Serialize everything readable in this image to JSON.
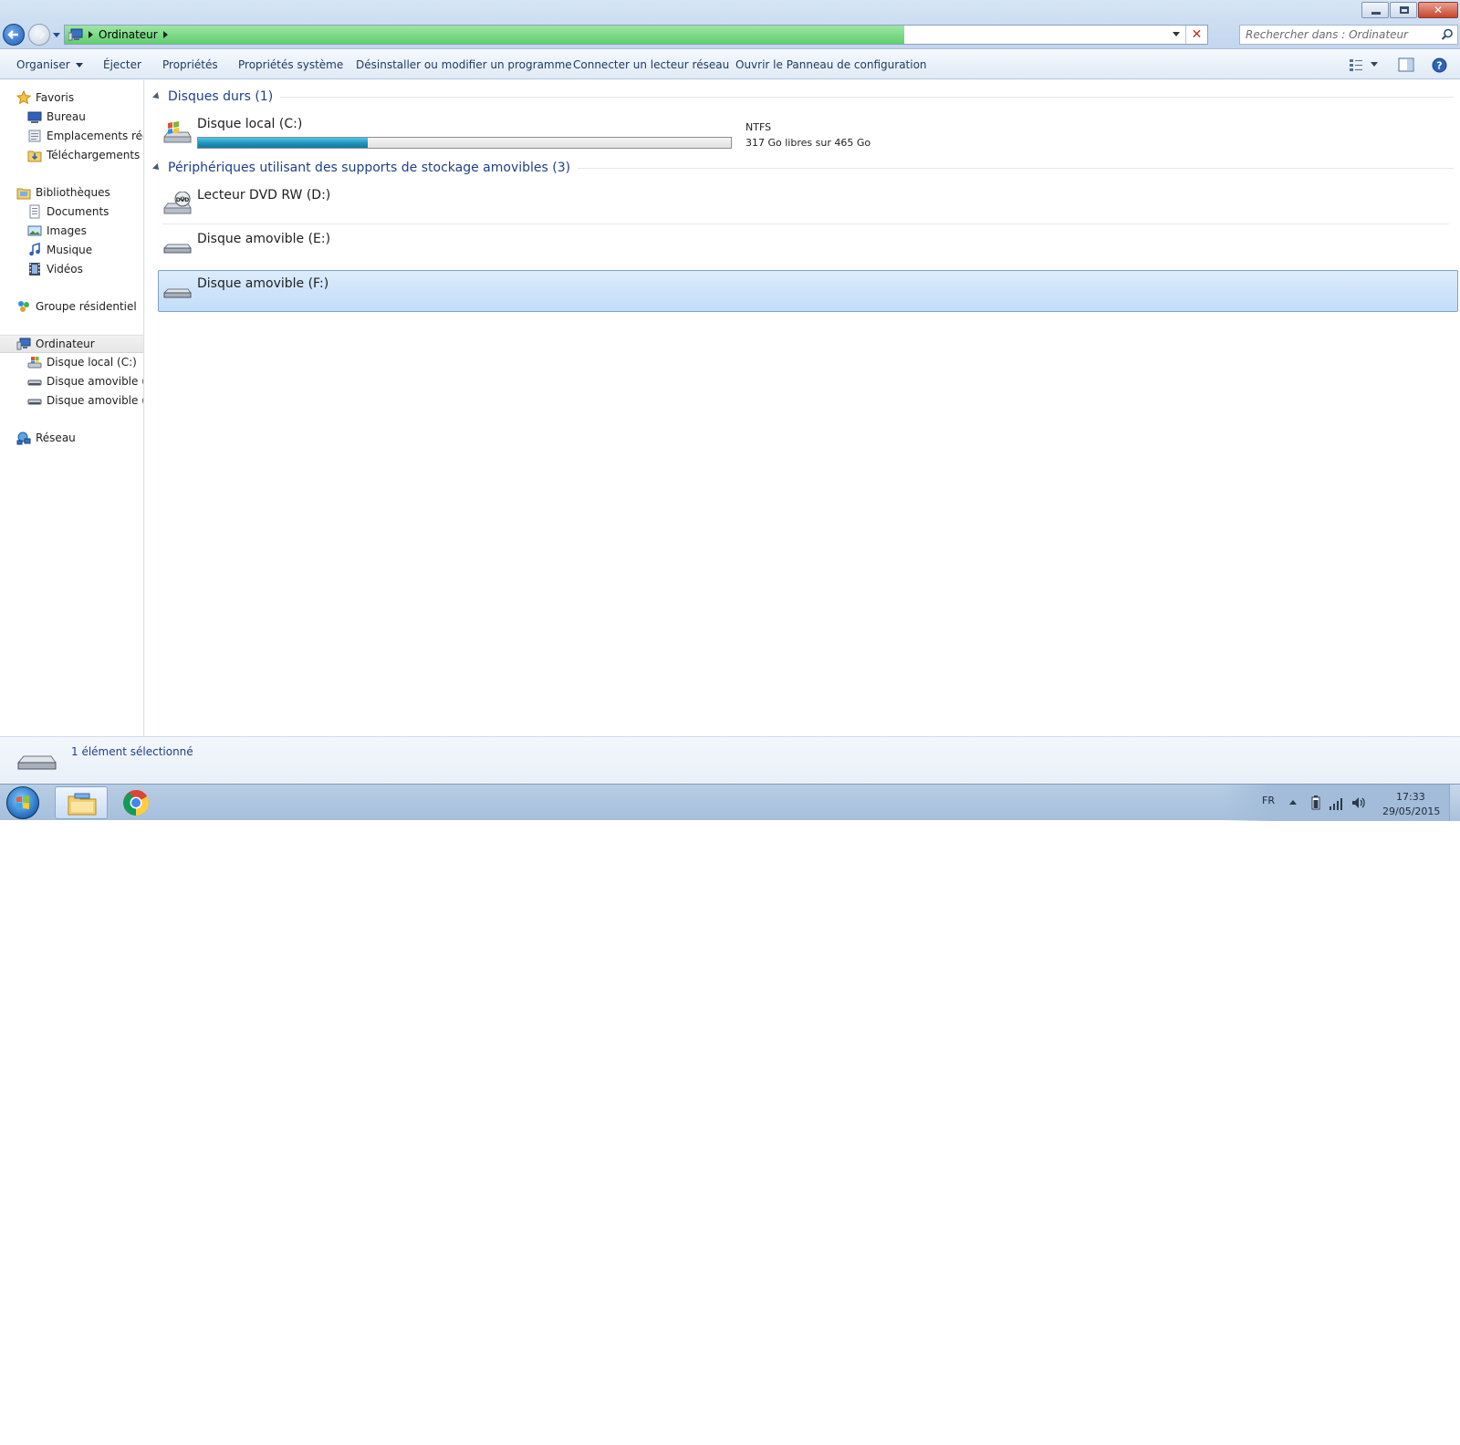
{
  "window": {
    "controls": {
      "minimize": "minimize-icon",
      "maximize": "restore-icon",
      "close_glyph": "✕"
    },
    "address": {
      "path": [
        "Ordinateur"
      ],
      "progress": 0.735
    },
    "search": {
      "placeholder": "Rechercher dans : Ordinateur"
    }
  },
  "commandbar": {
    "items": [
      "Organiser",
      "Éjecter",
      "Propriétés",
      "Propriétés système",
      "Désinstaller ou modifier un programme",
      "Connecter un lecteur réseau",
      "Ouvrir le Panneau de configuration"
    ]
  },
  "navpane": {
    "favorites": {
      "label": "Favoris",
      "items": [
        "Bureau",
        "Emplacements récents",
        "Téléchargements"
      ]
    },
    "libraries": {
      "label": "Bibliothèques",
      "items": [
        "Documents",
        "Images",
        "Musique",
        "Vidéos"
      ]
    },
    "homegroup": {
      "label": "Groupe résidentiel"
    },
    "computer": {
      "label": "Ordinateur",
      "items": [
        "Disque local (C:)",
        "Disque amovible (E:)",
        "Disque amovible (F:)"
      ]
    },
    "network": {
      "label": "Réseau"
    }
  },
  "content": {
    "groups": [
      {
        "label": "Disques durs (1)",
        "drives": [
          {
            "name": "Disque local (C:)",
            "filesystem": "NTFS",
            "free_text": "317 Go libres sur 465 Go",
            "used_fraction": 0.318,
            "icon": "windows-drive-icon"
          }
        ]
      },
      {
        "label": "Périphériques utilisant des supports de stockage amovibles (3)",
        "drives": [
          {
            "name": "Lecteur DVD RW (D:)",
            "icon": "dvd-drive-icon"
          },
          {
            "name": "Disque amovible (E:)",
            "icon": "removable-drive-icon"
          },
          {
            "name": "Disque amovible (F:)",
            "icon": "removable-drive-icon",
            "selected": true
          }
        ]
      }
    ]
  },
  "details": {
    "text": "1 élément sélectionné"
  },
  "taskbar": {
    "apps": [
      "explorer-icon",
      "chrome-icon"
    ],
    "tray": {
      "lang": "FR",
      "time": "17:33",
      "date": "29/05/2015"
    }
  },
  "colors": {
    "accent": "#1e3f8a",
    "selection": "#c2dcf8",
    "progress": "#5fcf6c",
    "usage_bar": "#1a8fb8"
  }
}
